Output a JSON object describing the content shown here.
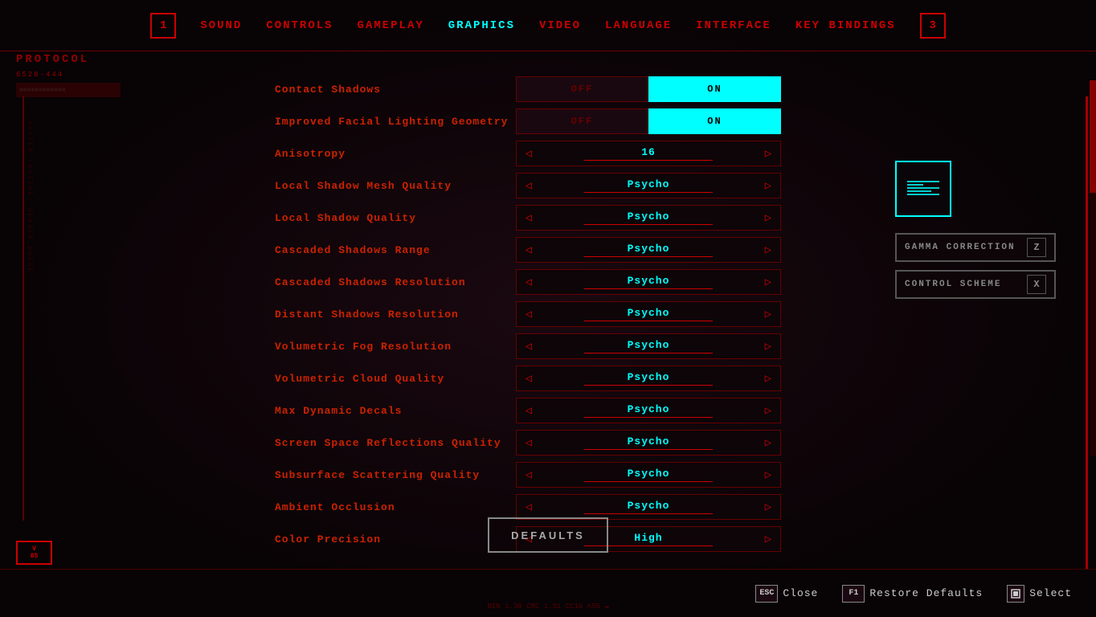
{
  "nav": {
    "items": [
      {
        "id": "sound",
        "label": "SOUND",
        "active": false
      },
      {
        "id": "controls",
        "label": "CONTROLS",
        "active": false
      },
      {
        "id": "gameplay",
        "label": "GAMEPLAY",
        "active": false
      },
      {
        "id": "graphics",
        "label": "GRAPHICS",
        "active": true
      },
      {
        "id": "video",
        "label": "VIDEO",
        "active": false
      },
      {
        "id": "language",
        "label": "LANGUAGE",
        "active": false
      },
      {
        "id": "interface",
        "label": "INTERFACE",
        "active": false
      },
      {
        "id": "key_bindings",
        "label": "KEY BINDINGS",
        "active": false
      }
    ],
    "num_left": "1",
    "num_right": "3"
  },
  "settings": [
    {
      "label": "Contact Shadows",
      "type": "toggle",
      "value": "ON",
      "off": "OFF"
    },
    {
      "label": "Improved Facial Lighting Geometry",
      "type": "toggle",
      "value": "ON",
      "off": "OFF"
    },
    {
      "label": "Anisotropy",
      "type": "slider",
      "value": "16"
    },
    {
      "label": "Local Shadow Mesh Quality",
      "type": "slider",
      "value": "Psycho"
    },
    {
      "label": "Local Shadow Quality",
      "type": "slider",
      "value": "Psycho"
    },
    {
      "label": "Cascaded Shadows Range",
      "type": "slider",
      "value": "Psycho"
    },
    {
      "label": "Cascaded Shadows Resolution",
      "type": "slider",
      "value": "Psycho"
    },
    {
      "label": "Distant Shadows Resolution",
      "type": "slider",
      "value": "Psycho"
    },
    {
      "label": "Volumetric Fog Resolution",
      "type": "slider",
      "value": "Psycho"
    },
    {
      "label": "Volumetric Cloud Quality",
      "type": "slider",
      "value": "Psycho"
    },
    {
      "label": "Max Dynamic Decals",
      "type": "slider",
      "value": "Psycho"
    },
    {
      "label": "Screen Space Reflections Quality",
      "type": "slider",
      "value": "Psycho"
    },
    {
      "label": "Subsurface Scattering Quality",
      "type": "slider",
      "value": "Psycho"
    },
    {
      "label": "Ambient Occlusion",
      "type": "slider",
      "value": "Psycho"
    },
    {
      "label": "Color Precision",
      "type": "slider",
      "value": "High"
    }
  ],
  "buttons": {
    "defaults": "DEFAULTS",
    "gamma_correction": "GAMMA CORRECTION",
    "gamma_key": "Z",
    "control_scheme": "CONTROL SCHEME",
    "control_key": "X"
  },
  "bottom_bar": {
    "close_key": "ESC",
    "close_label": "Close",
    "restore_key": "F1",
    "restore_label": "Restore Defaults",
    "select_label": "Select"
  },
  "version": {
    "line1": "V",
    "line2": "85"
  },
  "protocol": {
    "name": "PROTOCOL",
    "code": "6520-444"
  },
  "colors": {
    "accent": "#cc0000",
    "cyan": "#00ffff",
    "bg": "#080305",
    "text_active": "#cc2200"
  }
}
